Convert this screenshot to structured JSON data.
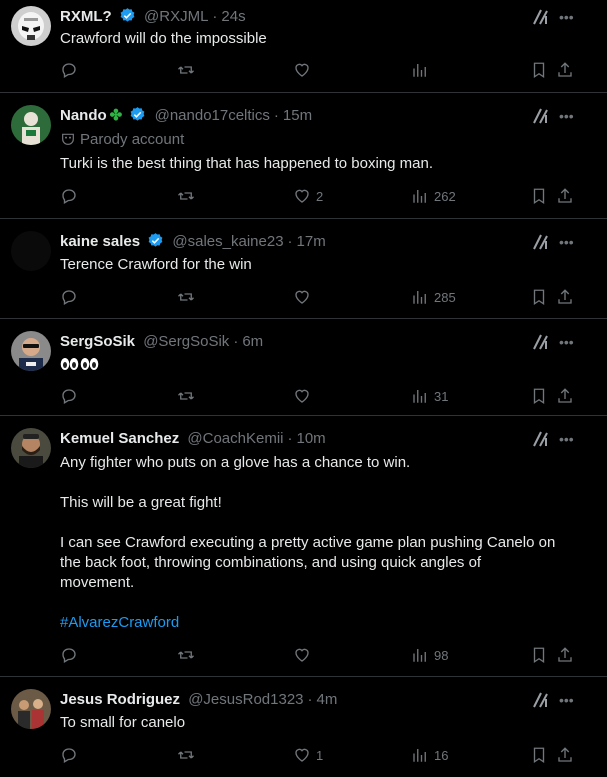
{
  "tweets": [
    {
      "name": "RXML?",
      "verified": true,
      "handle": "@RXJML",
      "sep": "·",
      "time": "24s",
      "parody": null,
      "lines": [
        "Crawford will do the impossible"
      ],
      "counts": {
        "reply": "",
        "retweet": "",
        "like": "",
        "views": ""
      },
      "avatar": "stormtrooper-avatar"
    },
    {
      "name": "Nando",
      "clover": "✤",
      "verified": true,
      "handle": "@nando17celtics",
      "sep": "·",
      "time": "15m",
      "parody": "Parody account",
      "lines": [
        "Turki is the best thing that has happened to boxing man."
      ],
      "counts": {
        "reply": "",
        "retweet": "",
        "like": "2",
        "views": "262"
      },
      "avatar": "celtics-player-avatar"
    },
    {
      "name": "kaine sales",
      "verified": true,
      "handle": "@sales_kaine23",
      "sep": "·",
      "time": "17m",
      "parody": null,
      "lines": [
        "Terence Crawford for the win"
      ],
      "counts": {
        "reply": "",
        "retweet": "",
        "like": "",
        "views": "285"
      },
      "avatar": "blank-avatar"
    },
    {
      "name": "SergSoSik",
      "verified": false,
      "handle": "@SergSoSik",
      "sep": "·",
      "time": "6m",
      "parody": null,
      "lines": [
        ""
      ],
      "counts": {
        "reply": "",
        "retweet": "",
        "like": "",
        "views": "31"
      },
      "avatar": "man-sunglasses-avatar"
    },
    {
      "name": "Kemuel Sanchez",
      "verified": false,
      "handle": "@CoachKemii",
      "sep": "·",
      "time": "10m",
      "parody": null,
      "lines": [
        "Any fighter who puts on a glove has a chance to win.",
        "",
        "This will be a great fight!",
        "",
        "I can see Crawford executing a pretty active game plan pushing Canelo on",
        "the back foot, throwing combinations, and using quick angles of",
        "movement.",
        "",
        "#AlvarezCrawford"
      ],
      "counts": {
        "reply": "",
        "retweet": "",
        "like": "",
        "views": "98"
      },
      "avatar": "bearded-man-avatar"
    },
    {
      "name": "Jesus Rodriguez",
      "verified": false,
      "handle": "@JesusRod1323",
      "sep": "·",
      "time": "4m",
      "parody": null,
      "lines": [
        "To small for canelo"
      ],
      "counts": {
        "reply": "",
        "retweet": "",
        "like": "1",
        "views": "16"
      },
      "avatar": "group-photo-avatar"
    }
  ]
}
